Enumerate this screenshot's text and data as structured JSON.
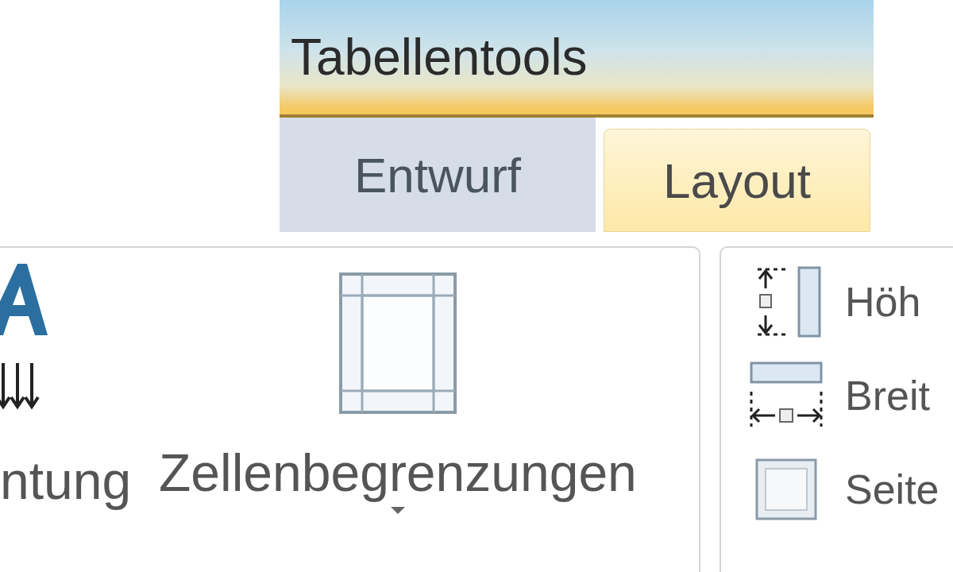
{
  "tool_header": {
    "title": "Tabellentools"
  },
  "tabs": [
    {
      "label": "Entwurf",
      "selected": false
    },
    {
      "label": "Layout",
      "selected": true
    }
  ],
  "ribbon": {
    "groups": [
      {
        "buttons": [
          {
            "kind": "text-direction",
            "label": "ntung"
          },
          {
            "kind": "cell-margins",
            "label": "Zellenbegrenzungen",
            "dropdown": true
          }
        ]
      },
      {
        "buttons": [
          {
            "kind": "height",
            "label": "Höh"
          },
          {
            "kind": "width",
            "label": "Breit"
          },
          {
            "kind": "page",
            "label": "Seite"
          }
        ]
      }
    ]
  }
}
